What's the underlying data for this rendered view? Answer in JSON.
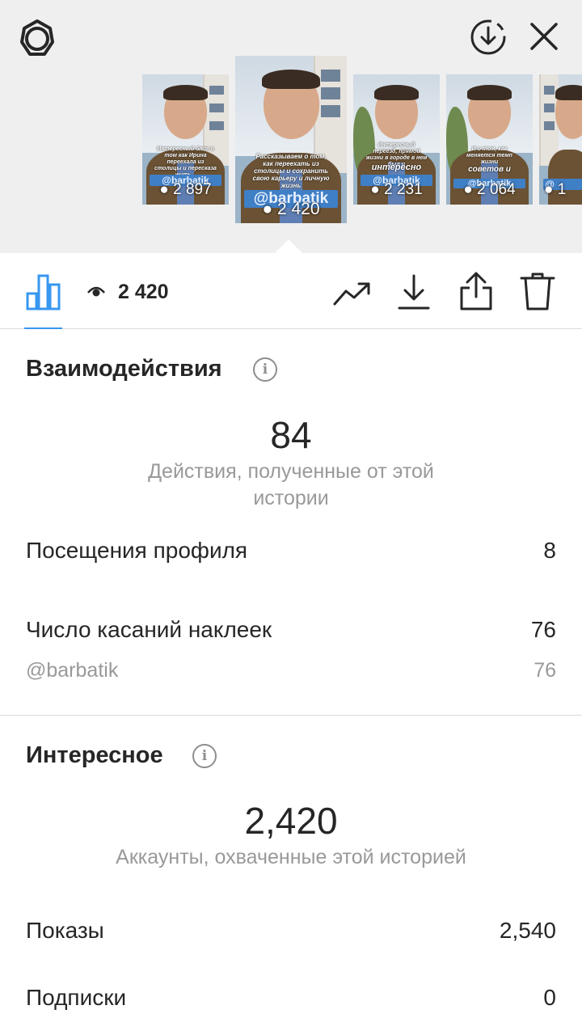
{
  "header": {
    "settings_icon": "gear-icon",
    "download_icon": "download-circle-icon",
    "close_icon": "close-icon"
  },
  "stories": [
    {
      "caption": "Интересный блог о том как Ирина переехала из столицы и пересказа жить...",
      "tag": "@barbatik",
      "views": "2 897"
    },
    {
      "caption": "Рассказываем о том, как переехать из столицы и сохранить свою карьеру и личную жизнь",
      "tag": "@barbatik",
      "views": "2 420"
    },
    {
      "caption": "Интересный переезд, прямой жизни в городе в нем был и",
      "highlight": "интересно",
      "tag": "@barbatik",
      "views": "2 231"
    },
    {
      "caption": "И о том, как меняется темп жизни",
      "highlight": "советов и",
      "tag": "@barbatik",
      "views": "2 064"
    },
    {
      "caption": "",
      "tag": "@",
      "views": "1"
    }
  ],
  "toolbar": {
    "insights_tab_icon": "bar-chart-icon",
    "views_icon": "eye-icon",
    "views_count": "2 420",
    "promote_icon": "trending-up-icon",
    "download_icon": "download-icon",
    "share_icon": "share-icon",
    "delete_icon": "trash-icon"
  },
  "interactions": {
    "title": "Взаимодействия",
    "total": "84",
    "total_label": "Действия, полученные от этой истории",
    "rows": [
      {
        "label": "Посещения профиля",
        "value": "8"
      },
      {
        "label": "Число касаний наклеек",
        "value": "76"
      }
    ],
    "sub_rows": [
      {
        "label": "@barbatik",
        "value": "76"
      }
    ]
  },
  "discovery": {
    "title": "Интересное",
    "total": "2,420",
    "total_label": "Аккаунты, охваченные этой историей",
    "rows": [
      {
        "label": "Показы",
        "value": "2,540"
      },
      {
        "label": "Подписки",
        "value": "0"
      }
    ]
  },
  "colors": {
    "accent": "#3897f0",
    "tag_bg": "#3f7fc6",
    "muted_text": "#999999",
    "strip_bg": "#efefef"
  }
}
